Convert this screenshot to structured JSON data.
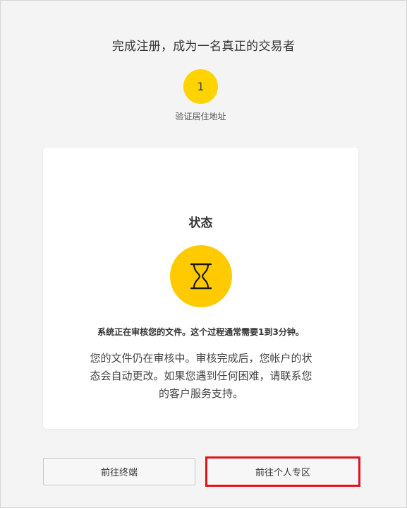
{
  "page": {
    "title": "完成注册，成为一名真正的交易者"
  },
  "step": {
    "number": "1",
    "label": "验证居住地址",
    "color": "#ffd300"
  },
  "status_card": {
    "title": "状态",
    "icon": "hourglass-icon",
    "icon_color": "#ffcb00",
    "headline": "系统正在审核您的文件。这个过程通常需要1到3分钟。",
    "body": "您的文件仍在审核中。审核完成后，您帐户的状态会自动更改。如果您遇到任何困难，请联系您的客户服务支持。"
  },
  "actions": {
    "terminal_label": "前往终端",
    "personal_area_label": "前往个人专区"
  },
  "highlight": {
    "color": "#e0141e",
    "target": "personal-area-button"
  }
}
